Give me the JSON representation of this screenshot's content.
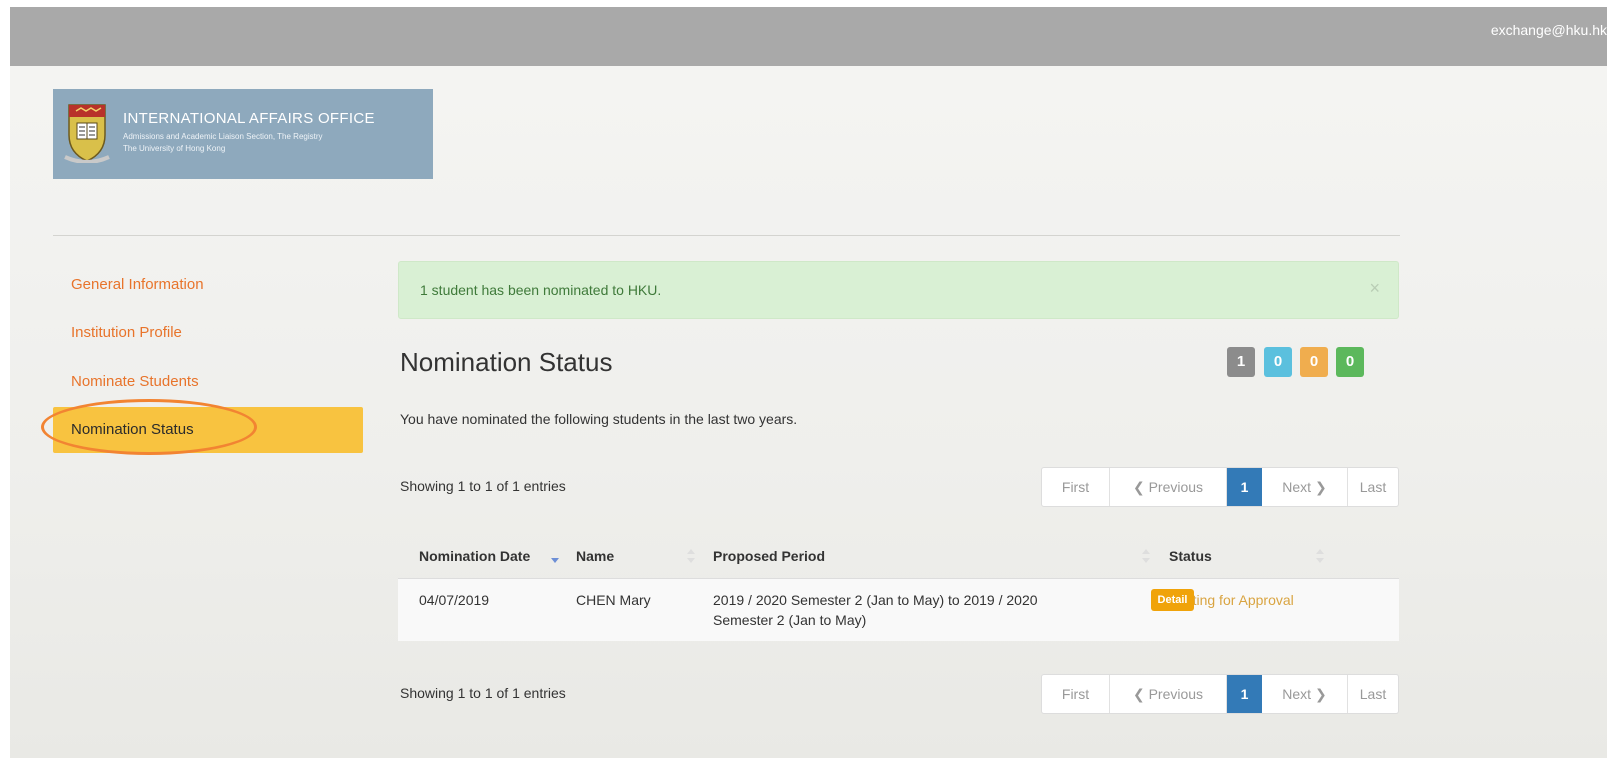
{
  "header": {
    "user_email": "exchange@hku.hk"
  },
  "logo": {
    "title": "INTERNATIONAL AFFAIRS OFFICE",
    "line1": "Admissions and Academic Liaison Section, The Registry",
    "line2": "The University of Hong Kong"
  },
  "sidebar": {
    "items": [
      {
        "label": "General Information"
      },
      {
        "label": "Institution Profile"
      },
      {
        "label": "Nominate Students"
      },
      {
        "label": "Nomination Status"
      }
    ],
    "active_index": 3
  },
  "alert": {
    "message": "1 student has been nominated to HKU.",
    "close": "×"
  },
  "page": {
    "title": "Nomination Status",
    "description": "You have nominated the following students in the last two years."
  },
  "counts": [
    {
      "value": "1",
      "color": "#8c8c8c"
    },
    {
      "value": "0",
      "color": "#5bc0de"
    },
    {
      "value": "0",
      "color": "#f0ad4e"
    },
    {
      "value": "0",
      "color": "#5cb85c"
    }
  ],
  "pagination": {
    "info": "Showing 1 to 1 of 1 entries",
    "first": "First",
    "previous": "Previous",
    "current": "1",
    "next": "Next",
    "last": "Last"
  },
  "table": {
    "columns": [
      "Nomination Date",
      "Name",
      "Proposed Period",
      "Status"
    ],
    "rows": [
      {
        "date": "04/07/2019",
        "name": "CHEN Mary",
        "period_line1": "2019 / 2020 Semester 2 (Jan to May) to 2019 / 2020",
        "period_line2": "Semester 2 (Jan to May)",
        "status": "Waiting for Approval",
        "action": "Detail"
      }
    ]
  },
  "colors": {
    "accent_orange": "#e8742b",
    "active_bg": "#f8c340",
    "primary_blue": "#337ab7",
    "detail_orange": "#f0a30a"
  }
}
